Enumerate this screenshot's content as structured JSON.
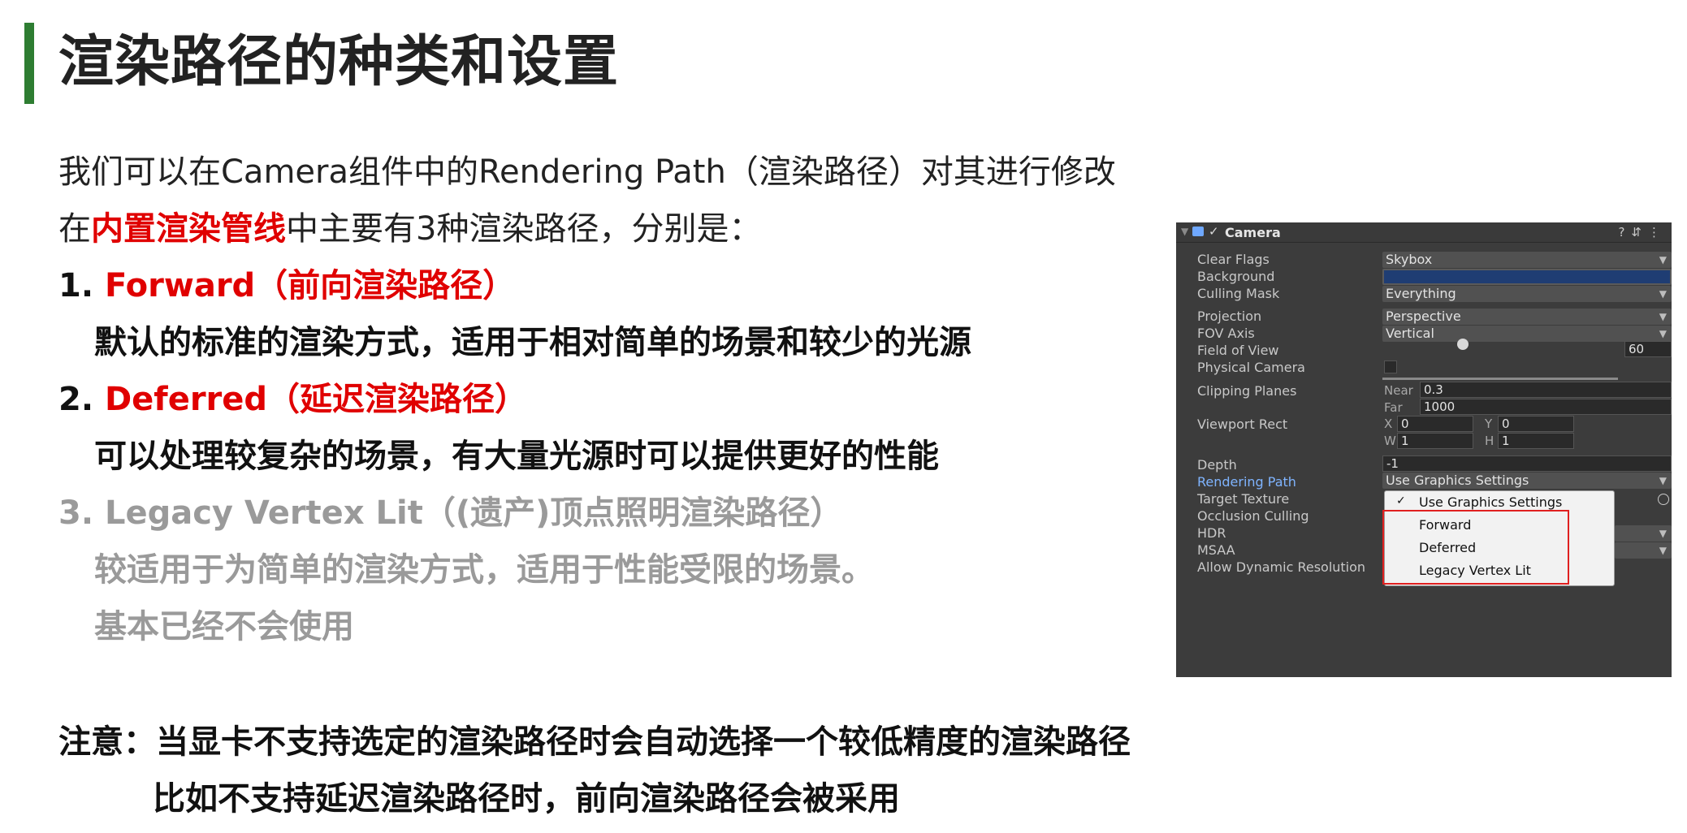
{
  "title": "渲染路径的种类和设置",
  "intro": {
    "line1": "我们可以在Camera组件中的Rendering Path（渲染路径）对其进行修改",
    "line2_pre": "在",
    "line2_red": "内置渲染管线",
    "line2_post": "中主要有3种渲染路径，分别是："
  },
  "items": [
    {
      "num": "1.",
      "name": "Forward（前向渲染路径）",
      "desc": "默认的标准的渲染方式，适用于相对简单的场景和较少的光源"
    },
    {
      "num": "2.",
      "name": "Deferred（延迟渲染路径）",
      "desc": "可以处理较复杂的场景，有大量光源时可以提供更好的性能"
    },
    {
      "num": "3.",
      "name": "Legacy Vertex Lit（(遗产)顶点照明渲染路径）",
      "desc": "较适用于为简单的渲染方式，适用于性能受限的场景。",
      "desc2": "基本已经不会使用"
    }
  ],
  "note": {
    "line1": "注意：当显卡不支持选定的渲染路径时会自动选择一个较低精度的渲染路径",
    "line2": "比如不支持延迟渲染路径时，前向渲染路径会被采用"
  },
  "inspector": {
    "header": "Camera",
    "labels": {
      "clear_flags": "Clear Flags",
      "background": "Background",
      "culling_mask": "Culling Mask",
      "projection": "Projection",
      "fov_axis": "FOV Axis",
      "field_of_view": "Field of View",
      "physical_camera": "Physical Camera",
      "clipping_planes": "Clipping Planes",
      "viewport_rect": "Viewport Rect",
      "depth": "Depth",
      "rendering_path": "Rendering Path",
      "target_texture": "Target Texture",
      "occlusion_culling": "Occlusion Culling",
      "hdr": "HDR",
      "msaa": "MSAA",
      "allow_dynamic_resolution": "Allow Dynamic Resolution"
    },
    "values": {
      "clear_flags": "Skybox",
      "culling_mask": "Everything",
      "projection": "Perspective",
      "fov_axis": "Vertical",
      "field_of_view": "60",
      "near_label": "Near",
      "near": "0.3",
      "far_label": "Far",
      "far": "1000",
      "x_label": "X",
      "x": "0",
      "y_label": "Y",
      "y": "0",
      "w_label": "W",
      "w": "1",
      "h_label": "H",
      "h": "1",
      "depth": "-1",
      "rendering_path": "Use Graphics Settings"
    },
    "menu_options": [
      "Use Graphics Settings",
      "Forward",
      "Deferred",
      "Legacy Vertex Lit"
    ],
    "selected_option": "Use Graphics Settings",
    "colors": {
      "background_field": "#1f3d73",
      "highlight_box": "#e02020",
      "panel": "#3c3c3c"
    }
  },
  "colors": {
    "accent_bar": "#2e7d32",
    "emphasis_red": "#e00000",
    "muted": "#9a9a9a"
  }
}
